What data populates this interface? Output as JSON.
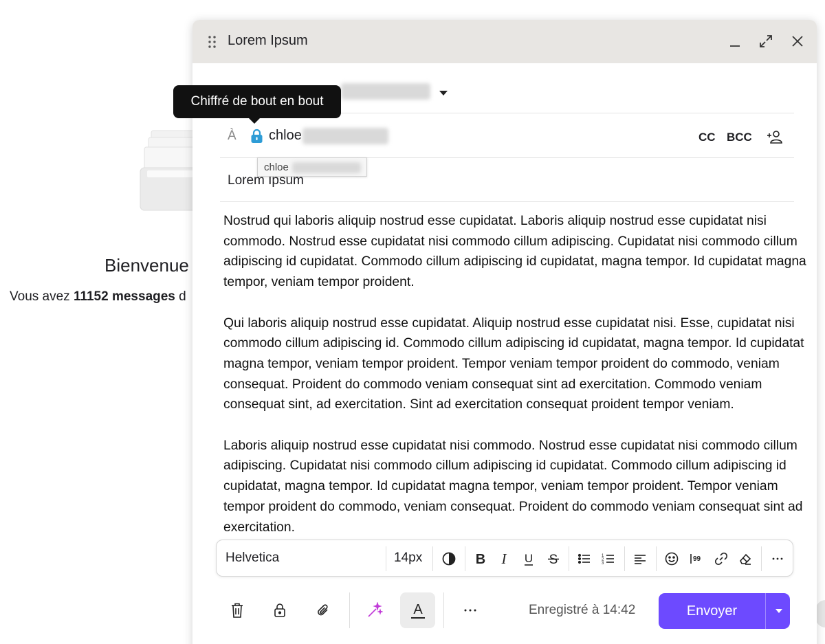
{
  "background": {
    "welcome_title": "Bienvenue",
    "welcome_prefix": "Vous avez ",
    "message_count": "11152 messages",
    "welcome_suffix": " d"
  },
  "composer": {
    "title": "Lorem Ipsum",
    "from_value": "",
    "to_label": "À",
    "to_recipient": "chloe",
    "cc_label": "CC",
    "bcc_label": "BCC",
    "subject": "Lorem Ipsum",
    "tooltip": "Chiffré de bout en bout",
    "suggestion": "chloe",
    "body_paragraphs": [
      "Nostrud qui laboris aliquip nostrud esse cupidatat. Laboris aliquip nostrud esse cupidatat nisi commodo. Nostrud esse cupidatat nisi commodo cillum adipiscing. Cupidatat nisi commodo cillum adipiscing id cupidatat. Commodo cillum adipiscing id cupidatat, magna tempor. Id cupidatat magna tempor, veniam tempor proident.",
      "Qui laboris aliquip nostrud esse cupidatat. Aliquip nostrud esse cupidatat nisi. Esse, cupidatat nisi commodo cillum adipiscing id. Commodo cillum adipiscing id cupidatat, magna tempor. Id cupidatat magna tempor, veniam tempor proident. Tempor veniam tempor proident do commodo, veniam consequat. Proident do commodo veniam consequat sint ad exercitation. Commodo veniam consequat sint, ad exercitation. Sint ad exercitation consequat proident tempor veniam.",
      "Laboris aliquip nostrud esse cupidatat nisi commodo. Nostrud esse cupidatat nisi commodo cillum adipiscing. Cupidatat nisi commodo cillum adipiscing id cupidatat. Commodo cillum adipiscing id cupidatat, magna tempor. Id cupidatat magna tempor, veniam tempor proident. Tempor veniam tempor proident do commodo, veniam consequat. Proident do commodo veniam consequat sint ad exercitation."
    ],
    "toolbar": {
      "font": "Helvetica",
      "size": "14px"
    },
    "footer": {
      "saved_text": "Enregistré à 14:42",
      "send_label": "Envoyer"
    }
  },
  "colors": {
    "accent": "#6d4aff",
    "lock": "#2e9cd6",
    "magic": "#c13bd8",
    "titlebar": "#e8e6e3"
  },
  "icons": [
    "drag-handle-icon",
    "minimize-icon",
    "maximize-icon",
    "close-icon",
    "lock-icon",
    "add-contact-icon",
    "contrast-icon",
    "bold-icon",
    "italic-icon",
    "underline-icon",
    "strikethrough-icon",
    "bullet-list-icon",
    "numbered-list-icon",
    "align-left-icon",
    "emoji-icon",
    "quote-icon",
    "link-icon",
    "eraser-icon",
    "more-icon",
    "trash-icon",
    "padlock-icon",
    "paperclip-icon",
    "magic-wand-icon",
    "text-format-icon",
    "chevron-down-icon"
  ]
}
